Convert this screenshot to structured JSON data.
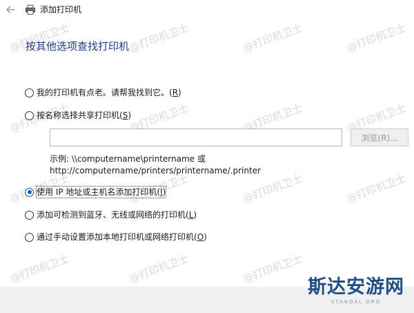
{
  "window": {
    "title": "添加打印机",
    "back_icon": "back-arrow-icon",
    "printer_icon": "printer-icon"
  },
  "page": {
    "heading": "按其他选项查找打印机"
  },
  "options": [
    {
      "label": "我的打印机有点老。请帮我找到它。",
      "hotkey": "R",
      "selected": false
    },
    {
      "label": "按名称选择共享打印机",
      "hotkey": "S",
      "selected": false
    },
    {
      "label": "使用 IP 地址或主机名添加打印机",
      "hotkey": "I",
      "selected": true
    },
    {
      "label": "添加可检测到蓝牙、无线或网络的打印机",
      "hotkey": "L",
      "selected": false
    },
    {
      "label": "通过手动设置添加本地打印机或网络打印机",
      "hotkey": "O",
      "selected": false
    }
  ],
  "shared_printer": {
    "input_value": "",
    "browse_label": "浏览(R)...",
    "example_line1": "示例: \\\\computername\\printername 或",
    "example_line2": "http://computername/printers/printername/.printer"
  },
  "watermark_text": "@打印机卫士",
  "logo": {
    "main": "斯达安游网",
    "sub": "STANDAL.ORG"
  },
  "colors": {
    "heading": "#1e3d8f",
    "radio_selected": "#0a5fc9",
    "footer": "#f0f0f0",
    "logo": "#1f4f86"
  }
}
